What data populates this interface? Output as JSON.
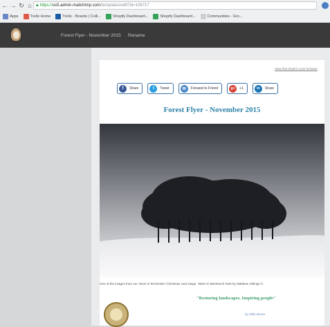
{
  "browser": {
    "url_https": "https://",
    "url_host": "us5.admin.mailchimp.com",
    "url_path": "/templates/edit?id=108717",
    "bookmarks": [
      {
        "label": "Apps",
        "color": "#6a86c6"
      },
      {
        "label": "Trello Home",
        "color": "#e05a4a"
      },
      {
        "label": "Trello - Boards | Colli...",
        "color": "#1a5da4"
      },
      {
        "label": "Shopify Dashboard...",
        "color": "#35a35a"
      },
      {
        "label": "Shopify Dashboard...",
        "color": "#35a35a"
      },
      {
        "label": "Communities - Gro...",
        "color": "#cfcfcf"
      }
    ]
  },
  "app": {
    "title": "Forest Flyer - November 2015",
    "separator": "·",
    "rename_label": "Rename"
  },
  "email": {
    "browser_link": "View this email in your browser",
    "social_buttons": [
      {
        "label": "Share",
        "icon": "facebook-icon",
        "glyph": "f",
        "color": "#3b5998"
      },
      {
        "label": "Tweet",
        "icon": "twitter-icon",
        "glyph": "t",
        "color": "#2a9ee0"
      },
      {
        "label": "Forward to Friend",
        "icon": "forward-icon",
        "glyph": "✉",
        "color": "#4a89c8"
      },
      {
        "label": "+1",
        "icon": "google-plus-icon",
        "glyph": "g+",
        "color": "#d9443a"
      },
      {
        "label": "Share",
        "icon": "linkedin-icon",
        "glyph": "in",
        "color": "#1b74b4"
      }
    ],
    "headline": "Forest Flyer - November 2015",
    "caption": "One of the images from our 'Store in Rochester' Christmas card range. Taken in Beetreech Park by Matthew Jetlings ©.",
    "tagline": "\"Restoring landscapes. Inspiring people\"",
    "small_link": "by Mike Moore"
  }
}
